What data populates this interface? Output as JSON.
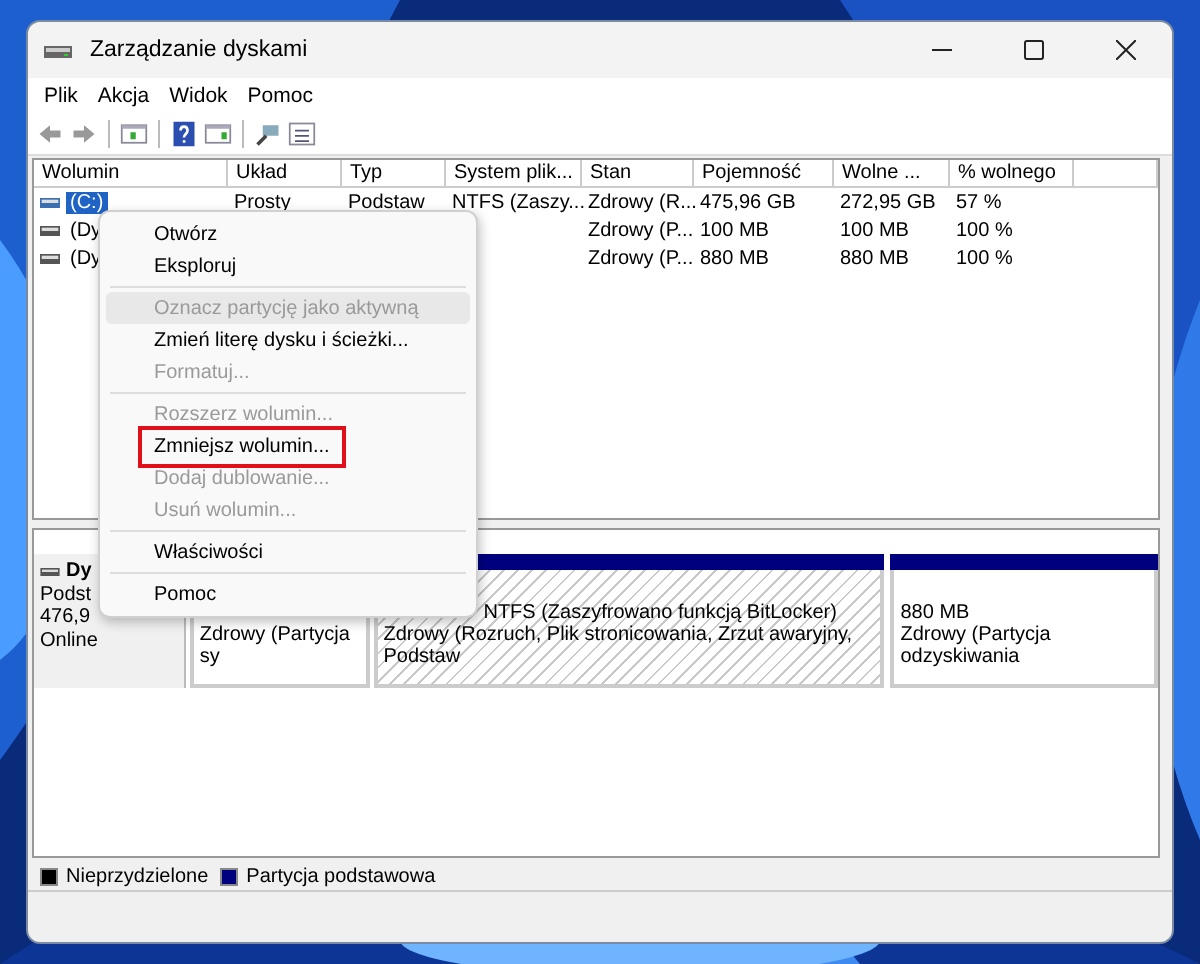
{
  "window": {
    "title": "Zarządzanie dyskami"
  },
  "menu_bar": [
    "Plik",
    "Akcja",
    "Widok",
    "Pomoc"
  ],
  "volume_list": {
    "columns": [
      "Wolumin",
      "Układ",
      "Typ",
      "System plik...",
      "Stan",
      "Pojemność",
      "Wolne ...",
      "% wolnego"
    ],
    "rows": [
      {
        "selected": true,
        "cells": [
          "(C:)",
          "Prosty",
          "Podstaw",
          "NTFS (Zaszy...",
          "Zdrowy (R...",
          "475,96 GB",
          "272,95 GB",
          "57 %"
        ]
      },
      {
        "selected": false,
        "cells": [
          "(Dy",
          "",
          "",
          "",
          "Zdrowy (P...",
          "100 MB",
          "100 MB",
          "100 %"
        ]
      },
      {
        "selected": false,
        "cells": [
          "(Dy",
          "",
          "",
          "",
          "Zdrowy (P...",
          "880 MB",
          "880 MB",
          "100 %"
        ]
      }
    ]
  },
  "disk": {
    "name": "Dy",
    "lines": [
      "Podst",
      "476,9",
      "Online"
    ],
    "partitions": [
      {
        "hatched": false,
        "lines": [
          "Zdrowy (Partycja sy"
        ]
      },
      {
        "hatched": true,
        "lines": [
          "NTFS (Zaszyfrowano funkcją BitLocker)",
          "Zdrowy (Rozruch, Plik stronicowania, Zrzut awaryjny, Podstaw"
        ]
      },
      {
        "hatched": false,
        "lines": [
          "880 MB",
          "Zdrowy (Partycja odzyskiwania"
        ]
      }
    ]
  },
  "legend": [
    {
      "label": "Nieprzydzielone",
      "color": "#000000"
    },
    {
      "label": "Partycja podstawowa",
      "color": "#00007f"
    }
  ],
  "context_menu": [
    {
      "kind": "item",
      "label": "Otwórz",
      "disabled": false,
      "hover": false,
      "outlined": false
    },
    {
      "kind": "item",
      "label": "Eksploruj",
      "disabled": false,
      "hover": false,
      "outlined": false
    },
    {
      "kind": "separator"
    },
    {
      "kind": "item",
      "label": "Oznacz partycję jako aktywną",
      "disabled": true,
      "hover": true,
      "outlined": false
    },
    {
      "kind": "item",
      "label": "Zmień literę dysku i ścieżki...",
      "disabled": false,
      "hover": false,
      "outlined": false
    },
    {
      "kind": "item",
      "label": "Formatuj...",
      "disabled": true,
      "hover": false,
      "outlined": false
    },
    {
      "kind": "separator"
    },
    {
      "kind": "item",
      "label": "Rozszerz wolumin...",
      "disabled": true,
      "hover": false,
      "outlined": false
    },
    {
      "kind": "item",
      "label": "Zmniejsz wolumin...",
      "disabled": false,
      "hover": false,
      "outlined": true
    },
    {
      "kind": "item",
      "label": "Dodaj dublowanie...",
      "disabled": true,
      "hover": false,
      "outlined": false
    },
    {
      "kind": "item",
      "label": "Usuń wolumin...",
      "disabled": true,
      "hover": false,
      "outlined": false
    },
    {
      "kind": "separator"
    },
    {
      "kind": "item",
      "label": "Właściwości",
      "disabled": false,
      "hover": false,
      "outlined": false
    },
    {
      "kind": "separator"
    },
    {
      "kind": "item",
      "label": "Pomoc",
      "disabled": false,
      "hover": false,
      "outlined": false
    }
  ]
}
